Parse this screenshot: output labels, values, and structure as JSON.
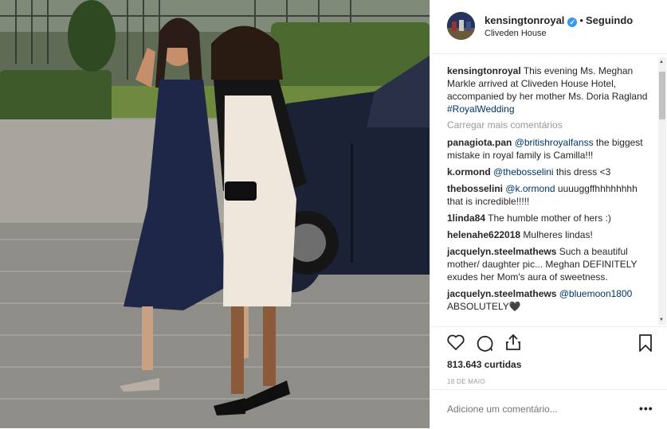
{
  "post": {
    "image_alt": "Photo",
    "header": {
      "username": "kensingtonroyal",
      "verified_icon": "verified-badge-icon",
      "separator": "•",
      "follow_status": "Seguindo",
      "location": "Cliveden House"
    },
    "load_more": "Carregar mais comentários",
    "comments": [
      {
        "user": "kensingtonroyal",
        "text": "This evening Ms. Meghan Markle arrived at Cliveden House Hotel, accompanied by her mother Ms. Doria Ragland ",
        "mention": "#RoyalWedding",
        "after": ""
      },
      {
        "user": "panagiota.pan",
        "text": "",
        "mention": "@britishroyalfanss",
        "after": " the biggest mistake in royal family is Camilla!!!"
      },
      {
        "user": "k.ormond",
        "text": "",
        "mention": "@thebosselini",
        "after": " this dress <3"
      },
      {
        "user": "thebosselini",
        "text": "",
        "mention": "@k.ormond",
        "after": " uuuuggffhhhhhhhh that is incredible!!!!!"
      },
      {
        "user": "1linda84",
        "text": "The humble mother of hers :)",
        "mention": "",
        "after": ""
      },
      {
        "user": "helenahe622018",
        "text": "Mulheres lindas!",
        "mention": "",
        "after": ""
      },
      {
        "user": "jacquelyn.steelmathews",
        "text": "Such a beautiful mother/ daughter pic... Meghan DEFINITELY exudes her Mom's aura of sweetness.",
        "mention": "",
        "after": ""
      },
      {
        "user": "jacquelyn.steelmathews",
        "text": "",
        "mention": "@bluemoon1800",
        "after": " ABSOLUTELY🖤"
      }
    ],
    "actions": {
      "like_icon": "heart-icon",
      "comment_icon": "comment-icon",
      "share_icon": "share-icon",
      "save_icon": "bookmark-icon"
    },
    "likes": "813.643 curtidas",
    "date": "18 DE MAIO",
    "add_comment_placeholder": "Adicione um comentário...",
    "more_options": "•••",
    "colors": {
      "link": "#003569",
      "verified": "#3897f0",
      "muted": "#999999"
    }
  }
}
